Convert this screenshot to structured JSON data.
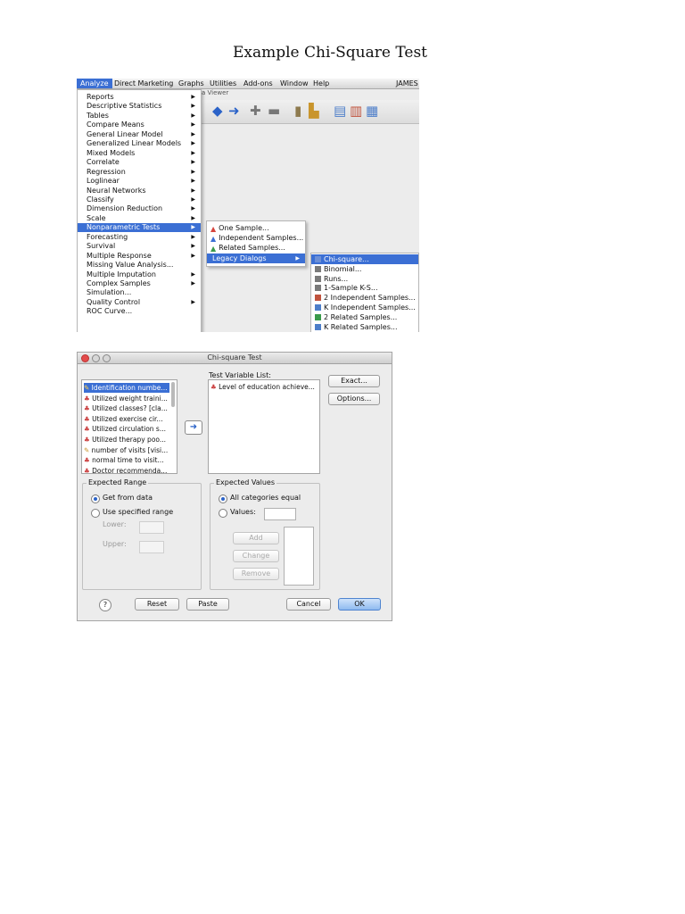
{
  "doc": {
    "title": "Example Chi-Square Test"
  },
  "menubar": {
    "items": [
      "Analyze",
      "Direct Marketing",
      "Graphs",
      "Utilities",
      "Add-ons",
      "Window",
      "Help",
      "JAMES"
    ],
    "viewer_title": "a Viewer"
  },
  "analyze_menu": {
    "items": [
      "Reports",
      "Descriptive Statistics",
      "Tables",
      "Compare Means",
      "General Linear Model",
      "Generalized Linear Models",
      "Mixed Models",
      "Correlate",
      "Regression",
      "Loglinear",
      "Neural Networks",
      "Classify",
      "Dimension Reduction",
      "Scale",
      "Nonparametric Tests",
      "Forecasting",
      "Survival",
      "Multiple Response",
      "Missing Value Analysis...",
      "Multiple Imputation",
      "Complex Samples",
      "Simulation...",
      "Quality Control",
      "ROC Curve..."
    ]
  },
  "nonparametric_menu": {
    "items": [
      "One Sample...",
      "Independent Samples...",
      "Related Samples...",
      "Legacy Dialogs"
    ]
  },
  "legacy_menu": {
    "items": [
      "Chi-square...",
      "Binomial...",
      "Runs...",
      "1-Sample K-S...",
      "2 Independent Samples...",
      "K Independent Samples...",
      "2 Related Samples...",
      "K Related Samples..."
    ]
  },
  "dialog": {
    "title": "Chi-square Test",
    "variables": [
      "Identification numbe...",
      "Utilized weight traini...",
      "Utilized classes? [cla...",
      "Utilized exercise cir...",
      "Utilized circulation s...",
      "Utilized therapy poo...",
      "number of visits [visi...",
      "normal time to visit...",
      "Doctor recommenda..."
    ],
    "test_variable_label": "Test Variable List:",
    "test_variables": [
      "Level of education achieve..."
    ],
    "exact_label": "Exact...",
    "options_label": "Options...",
    "expected_range": {
      "title": "Expected Range",
      "get_from_data": "Get from data",
      "use_specified": "Use specified range",
      "lower_label": "Lower:",
      "upper_label": "Upper:"
    },
    "expected_values": {
      "title": "Expected Values",
      "all_equal": "All categories equal",
      "values_label": "Values:",
      "add": "Add",
      "change": "Change",
      "remove": "Remove"
    },
    "help": "?",
    "reset": "Reset",
    "paste": "Paste",
    "cancel": "Cancel",
    "ok": "OK"
  }
}
